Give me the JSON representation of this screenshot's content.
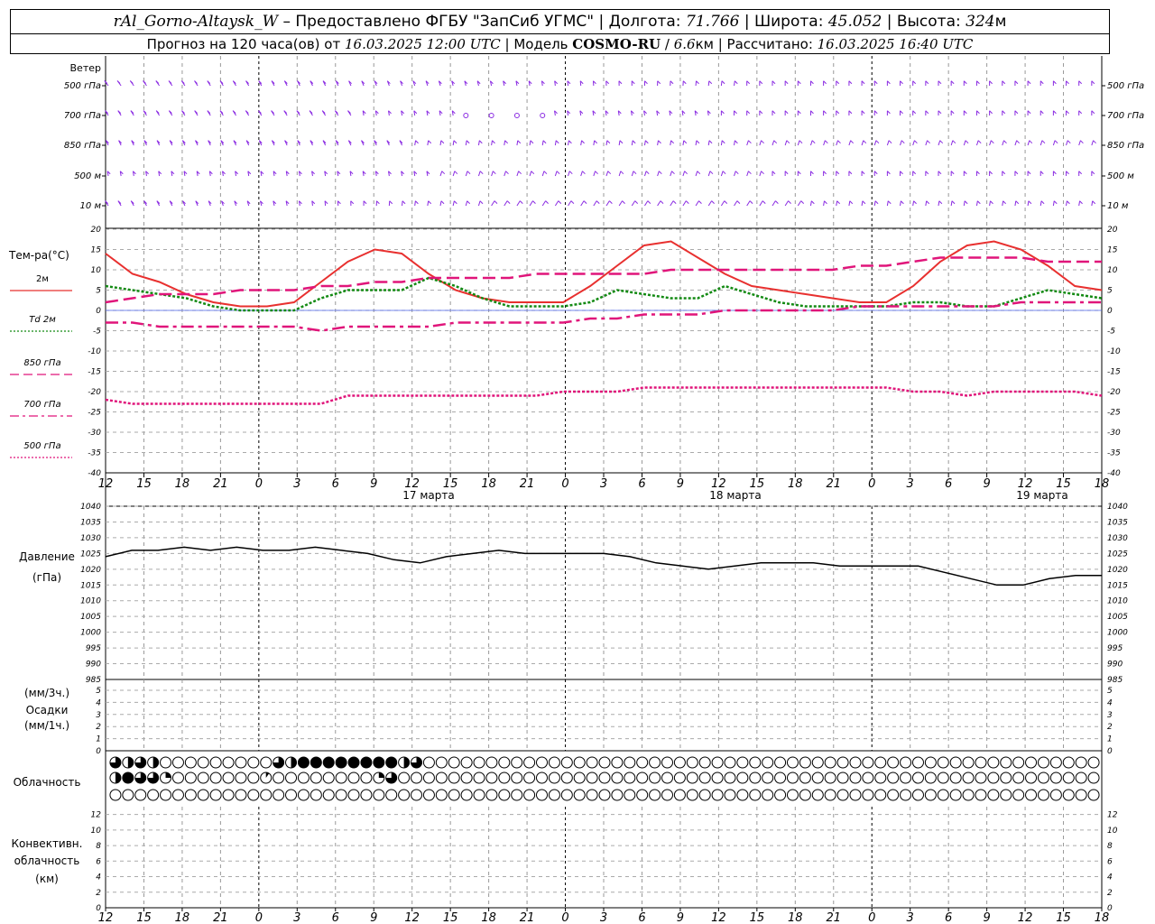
{
  "header": {
    "station": "rAl_Gorno-Altaysk_W",
    "provided_prefix": " – Предоставлено ФГБУ \"ЗапСиб УГМС\" | Долгота: ",
    "longitude": "71.766",
    "lat_label": " | Широта: ",
    "latitude": "45.052",
    "alt_label": " | Высота: ",
    "altitude": "324",
    "alt_unit": "м",
    "forecast_prefix": "Прогноз на 120 часа(ов) от ",
    "forecast_time": "16.03.2025 12:00 UTC",
    "model_label": " | Модель ",
    "model_name": "COSMO-RU",
    "model_sep": " / ",
    "model_res": "6.6",
    "model_res_unit": "км",
    "calc_label": " | Рассчитано: ",
    "calc_time": "16.03.2025 16:40 UTC"
  },
  "wind": {
    "title": "Ветер",
    "levels": [
      "500 гПа",
      "700 гПа",
      "850 гПа",
      "500 м",
      "10 м"
    ]
  },
  "temperature": {
    "title": "Тем-ра(°C)",
    "legend": [
      {
        "label": "2м",
        "color": "#e8302f",
        "style": "solid"
      },
      {
        "label": "Td 2м",
        "color": "#138a13",
        "style": "dotted"
      },
      {
        "label": "850 гПа",
        "color": "#e0157a",
        "style": "dash"
      },
      {
        "label": "700 гПа",
        "color": "#e0157a",
        "style": "dashdot"
      },
      {
        "label": "500 гПа",
        "color": "#e0157a",
        "style": "dotted"
      }
    ],
    "ticks": [
      "20",
      "15",
      "10",
      "5",
      "0",
      "-5",
      "-10",
      "-15",
      "-20",
      "-25",
      "-30",
      "-35",
      "-40"
    ]
  },
  "pressure": {
    "title": "Давление",
    "unit": "(гПа)",
    "ticks": [
      "1040",
      "1035",
      "1030",
      "1025",
      "1020",
      "1015",
      "1010",
      "1005",
      "1000",
      "995",
      "990",
      "985"
    ]
  },
  "precip": {
    "unit_top": "(мм/3ч.)",
    "title": "Осадки",
    "unit_bottom": "(мм/1ч.)",
    "ticks": [
      "5",
      "4",
      "3",
      "2",
      "1",
      "0"
    ]
  },
  "cloud": {
    "title": "Облачность"
  },
  "convective": {
    "title_line1": "Конвективн.",
    "title_line2": "облачность",
    "unit": "(км)",
    "ticks": [
      "12",
      "10",
      "8",
      "6",
      "4",
      "2",
      "0"
    ]
  },
  "time_axis": {
    "hours": [
      "12",
      "15",
      "18",
      "21",
      "0",
      "3",
      "6",
      "9",
      "12",
      "15",
      "18",
      "21",
      "0",
      "3",
      "6",
      "9",
      "12",
      "15",
      "18",
      "21",
      "0",
      "3",
      "6",
      "9",
      "12",
      "15",
      "18"
    ],
    "dates": [
      "17 марта",
      "18 марта",
      "19 марта"
    ]
  },
  "chart_data": {
    "type": "line",
    "x_hours_from_start": [
      0,
      3,
      6,
      9,
      12,
      15,
      18,
      21,
      24,
      27,
      30,
      33,
      36,
      39,
      42,
      45,
      48,
      51,
      54,
      57,
      60,
      63,
      66,
      69,
      72,
      75,
      78
    ],
    "temperature": {
      "ylim": [
        -40,
        20
      ],
      "series": [
        {
          "name": "2м",
          "values": [
            14,
            9,
            7,
            4,
            2,
            1,
            1,
            2,
            7,
            12,
            15,
            14,
            9,
            5,
            3,
            2,
            2,
            2,
            6,
            11,
            16,
            17,
            13,
            9,
            6,
            5,
            4,
            3,
            2,
            2,
            6,
            12,
            16,
            17,
            15,
            11,
            6,
            5
          ]
        },
        {
          "name": "Td 2м",
          "values": [
            6,
            5,
            4,
            3,
            1,
            0,
            0,
            0,
            3,
            5,
            5,
            5,
            8,
            6,
            3,
            1,
            1,
            1,
            2,
            5,
            4,
            3,
            3,
            6,
            4,
            2,
            1,
            1,
            1,
            1,
            2,
            2,
            1,
            1,
            3,
            5,
            4,
            3
          ]
        },
        {
          "name": "850 гПа",
          "values": [
            2,
            3,
            4,
            4,
            4,
            5,
            5,
            5,
            6,
            6,
            7,
            7,
            8,
            8,
            8,
            8,
            9,
            9,
            9,
            9,
            9,
            10,
            10,
            10,
            10,
            10,
            10,
            10,
            11,
            11,
            12,
            13,
            13,
            13,
            13,
            12,
            12,
            12
          ]
        },
        {
          "name": "700 гПа",
          "values": [
            -3,
            -3,
            -4,
            -4,
            -4,
            -4,
            -4,
            -4,
            -5,
            -4,
            -4,
            -4,
            -4,
            -3,
            -3,
            -3,
            -3,
            -3,
            -2,
            -2,
            -1,
            -1,
            -1,
            0,
            0,
            0,
            0,
            0,
            1,
            1,
            1,
            1,
            1,
            1,
            2,
            2,
            2,
            2
          ]
        },
        {
          "name": "500 гПа",
          "values": [
            -22,
            -23,
            -23,
            -23,
            -23,
            -23,
            -23,
            -23,
            -23,
            -21,
            -21,
            -21,
            -21,
            -21,
            -21,
            -21,
            -21,
            -20,
            -20,
            -20,
            -19,
            -19,
            -19,
            -19,
            -19,
            -19,
            -19,
            -19,
            -19,
            -19,
            -20,
            -20,
            -21,
            -20,
            -20,
            -20,
            -20,
            -21
          ]
        }
      ]
    },
    "pressure": {
      "ylim": [
        985,
        1040
      ],
      "values": [
        1024,
        1026,
        1026,
        1027,
        1026,
        1027,
        1026,
        1026,
        1027,
        1026,
        1025,
        1023,
        1022,
        1024,
        1025,
        1026,
        1025,
        1025,
        1025,
        1025,
        1024,
        1022,
        1021,
        1020,
        1021,
        1022,
        1022,
        1022,
        1021,
        1021,
        1021,
        1021,
        1019,
        1017,
        1015,
        1015,
        1017,
        1018,
        1018
      ]
    },
    "precip": {
      "ylim": [
        0,
        5
      ],
      "values": []
    },
    "convective": {
      "ylim": [
        0,
        13
      ],
      "values": []
    },
    "cloud_layers": [
      [
        0.75,
        0.5,
        0.75,
        0.5,
        0,
        0,
        0,
        0,
        0,
        0,
        0,
        0,
        0,
        0.75,
        0.5,
        1,
        1,
        1,
        1,
        1,
        1,
        1,
        1,
        0.5,
        0.75,
        0,
        0,
        0,
        0,
        0,
        0,
        0,
        0,
        0,
        0,
        0,
        0,
        0,
        0,
        0,
        0,
        0,
        0,
        0,
        0,
        0,
        0,
        0,
        0,
        0,
        0,
        0,
        0,
        0,
        0,
        0,
        0,
        0,
        0,
        0,
        0,
        0,
        0,
        0,
        0,
        0,
        0,
        0,
        0,
        0,
        0,
        0,
        0,
        0,
        0,
        0,
        0,
        0,
        0,
        0
      ],
      [
        0.5,
        1,
        0.75,
        0.75,
        0.25,
        0,
        0,
        0,
        0,
        0,
        0,
        0,
        0.1,
        0,
        0,
        0,
        0,
        0,
        0,
        0,
        0,
        0.25,
        0.75,
        0,
        0,
        0,
        0,
        0,
        0,
        0,
        0,
        0,
        0,
        0,
        0,
        0,
        0,
        0,
        0,
        0,
        0,
        0,
        0,
        0,
        0,
        0,
        0,
        0,
        0,
        0,
        0,
        0,
        0,
        0,
        0,
        0,
        0,
        0,
        0,
        0,
        0,
        0,
        0,
        0,
        0,
        0,
        0,
        0,
        0,
        0,
        0,
        0,
        0,
        0,
        0,
        0,
        0,
        0,
        0,
        0
      ],
      [
        0,
        0,
        0,
        0,
        0,
        0,
        0,
        0,
        0,
        0,
        0,
        0,
        0,
        0,
        0,
        0,
        0,
        0,
        0,
        0,
        0,
        0,
        0,
        0,
        0,
        0,
        0,
        0,
        0,
        0,
        0,
        0,
        0,
        0,
        0,
        0,
        0,
        0,
        0,
        0,
        0,
        0,
        0,
        0,
        0,
        0,
        0,
        0,
        0,
        0,
        0,
        0,
        0,
        0,
        0,
        0,
        0,
        0,
        0,
        0,
        0,
        0,
        0,
        0,
        0,
        0,
        0,
        0,
        0,
        0,
        0,
        0,
        0,
        0,
        0,
        0,
        0,
        0,
        0,
        0
      ]
    ],
    "wind_color": "#8a2be2",
    "calm_marks_700": 4
  }
}
